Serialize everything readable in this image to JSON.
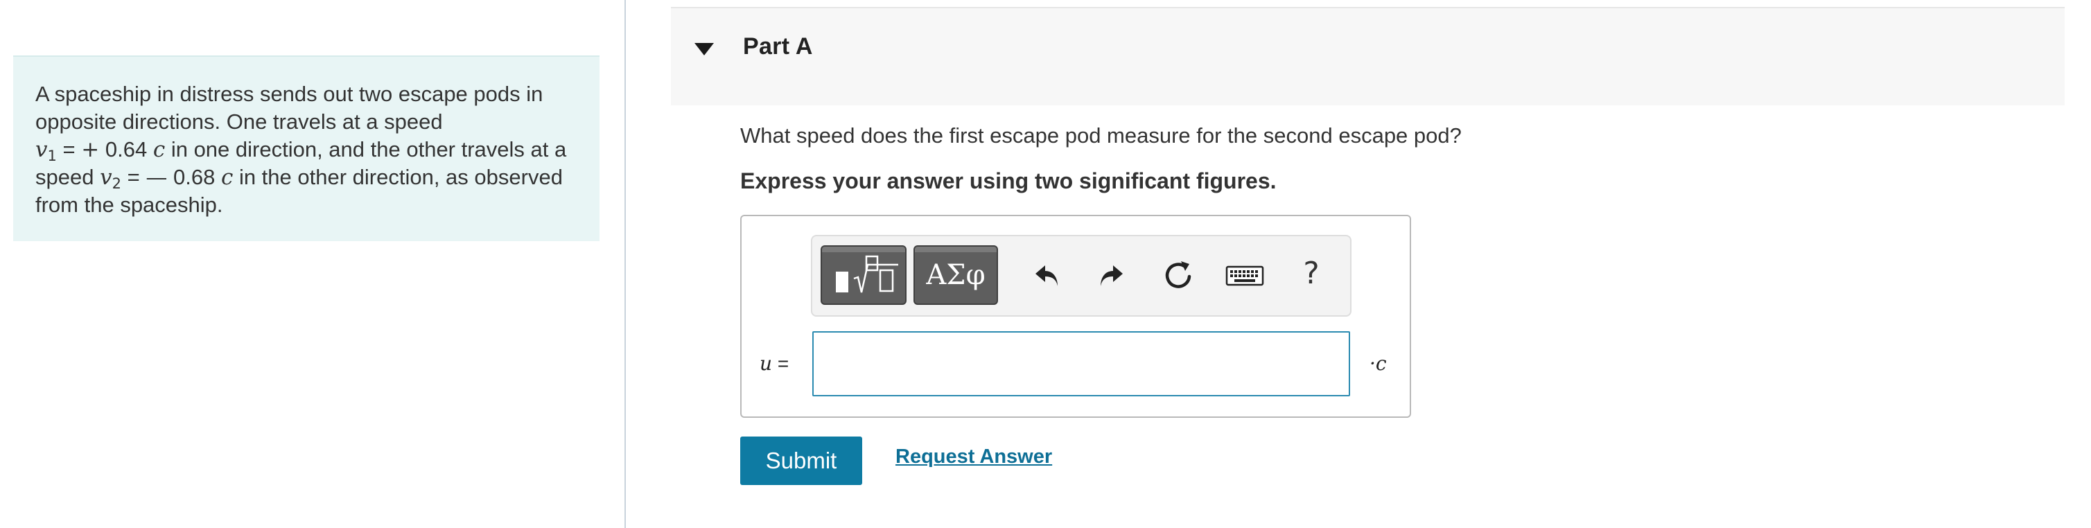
{
  "problem": {
    "text_1": "A spaceship in distress sends out two escape pods in opposite directions. One travels at a speed",
    "v1_symbol": "v",
    "v1_sub": "1",
    "eq": "=",
    "plus": "+",
    "v1_value": "0.64",
    "c": "c",
    "text_2": "in one direction, and the other travels at a speed",
    "v2_symbol": "v",
    "v2_sub": "2",
    "minus": "—",
    "v2_value": "0.68",
    "text_3": "in the other direction, as observed from the spaceship."
  },
  "part": {
    "title": "Part A"
  },
  "question": "What speed does the first escape pod measure for the second escape pod?",
  "instruction": "Express your answer using two significant figures.",
  "toolbar": {
    "symbols_label": "ΑΣφ",
    "help_label": "?"
  },
  "answer": {
    "variable": "u",
    "equals": "=",
    "value": "",
    "unit": "·c"
  },
  "actions": {
    "submit_label": "Submit",
    "request_answer_label": "Request Answer"
  }
}
